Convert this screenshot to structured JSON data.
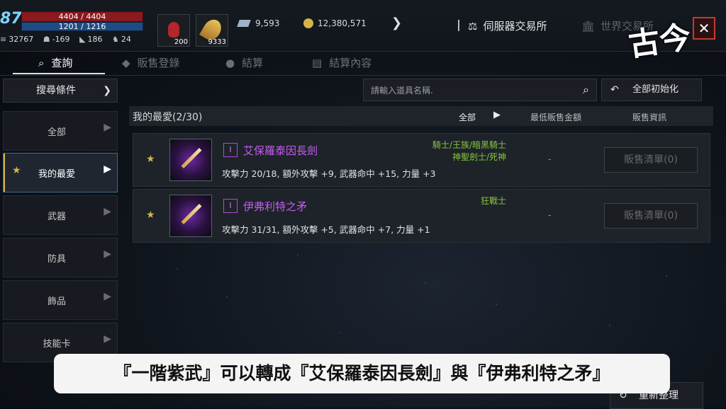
{
  "hud": {
    "level": "87",
    "hp": "4404 / 4404",
    "mp": "1201 / 1216",
    "stats": [
      {
        "icon": "shield-icon",
        "value": "32767"
      },
      {
        "icon": "helmet-icon",
        "value": "-169"
      },
      {
        "icon": "boot-icon",
        "value": "186"
      },
      {
        "icon": "beast-icon",
        "value": "24"
      }
    ],
    "slot1_count": "200",
    "slot2_count": "9333",
    "diamond": "9,593",
    "gold": "12,380,571",
    "server_exchange": "伺服器交易所",
    "world_exchange": "世界交易所",
    "logo": "古今"
  },
  "tabs": [
    "查詢",
    "販售登錄",
    "結算",
    "結算內容"
  ],
  "filter": {
    "label": "搜尋條件"
  },
  "search": {
    "placeholder": "請輸入道具名稱."
  },
  "reset_label": "全部初始化",
  "categories": [
    "全部",
    "我的最愛",
    "武器",
    "防具",
    "飾品",
    "技能卡"
  ],
  "list": {
    "title": "我的最愛(2/30)",
    "all": "全部",
    "col_price": "最低販售金額",
    "col_info": "販售資訊"
  },
  "items": [
    {
      "grade": "I",
      "name": "艾保羅泰因長劍",
      "class_line1": "騎士/王族/暗黑騎士",
      "class_line2": "神聖劍士/死神",
      "attrs": "攻擊力 20/18, 額外攻擊 +9, 武器命中 +15, 力量 +3",
      "price": "-",
      "sale": "販售清單(0)"
    },
    {
      "grade": "I",
      "name": "伊弗利特之矛",
      "class_line1": "狂戰士",
      "class_line2": "",
      "attrs": "攻擊力 31/31, 額外攻擊 +5, 武器命中 +7, 力量 +1",
      "price": "-",
      "sale": "販售清單(0)"
    }
  ],
  "subtitle": "『一階紫武』可以轉成『艾保羅泰因長劍』與『伊弗利特之矛』",
  "bottom_button": "重新整理"
}
